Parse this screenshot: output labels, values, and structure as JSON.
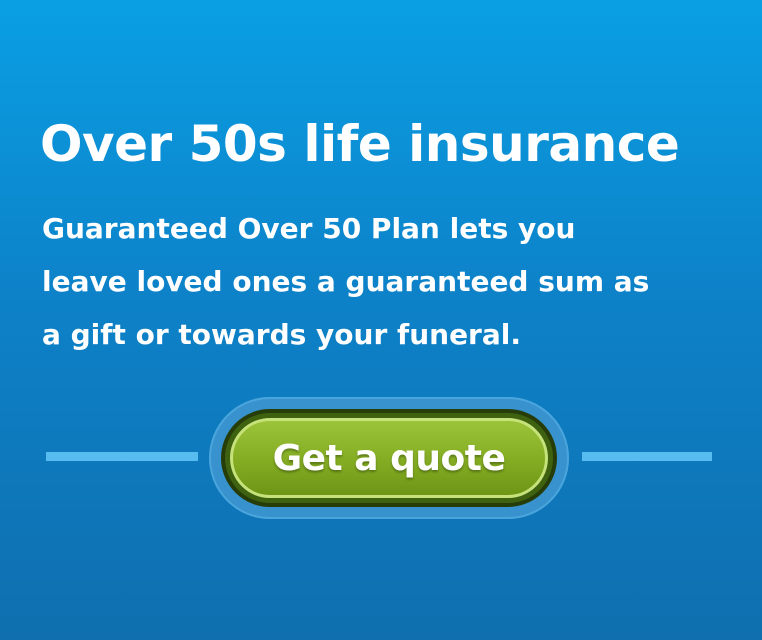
{
  "banner": {
    "headline": "Over 50s life insurance",
    "body_lines": [
      "Guaranteed Over 50 Plan lets you",
      "leave loved ones a guaranteed sum as",
      "a gift or towards your funeral."
    ],
    "cta_label": "Get a quote"
  },
  "colors": {
    "background_top": "#0a9fe3",
    "background_bottom": "#0f6faf",
    "divider": "#57bdf0",
    "button_green": "#86ae24",
    "button_border": "#263d0a",
    "text": "#ffffff"
  }
}
